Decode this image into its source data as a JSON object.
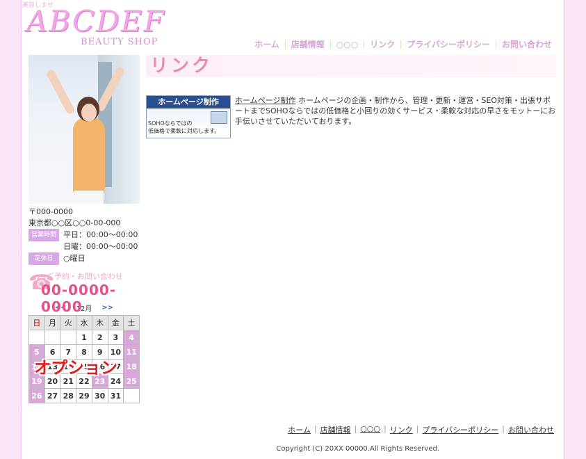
{
  "header": {
    "tagline": "美容しませ",
    "logo_main": "ABCDEF",
    "logo_sub": "BEAUTY  SHOP"
  },
  "global_nav": [
    {
      "label": "ホーム"
    },
    {
      "label": "店舗情報"
    },
    {
      "label": "○○○"
    },
    {
      "label": "リンク"
    },
    {
      "label": "プライバシーポリシー"
    },
    {
      "label": "お問い合わせ"
    }
  ],
  "sidebar": {
    "postal": "〒000-0000",
    "address": "東京都○○区○○0-00-000",
    "hours_label": "営業時間",
    "hours_weekday": "平日：00:00～00:00",
    "hours_sunday": "日曜：00:00～00:00",
    "closed_label": "定休日",
    "closed_value": "○曜日",
    "tel_caption": "ご予約・お問い合わせ",
    "tel_number": "00-0000-0000"
  },
  "calendar": {
    "prev": "<<",
    "next": ">>",
    "month": "12月",
    "weekdays": [
      "日",
      "月",
      "火",
      "水",
      "木",
      "金",
      "土"
    ],
    "weeks": [
      [
        "",
        "",
        "",
        "1",
        "2",
        "3",
        "4"
      ],
      [
        "5",
        "6",
        "7",
        "8",
        "9",
        "10",
        "11"
      ],
      [
        "12",
        "13",
        "14",
        "15",
        "16",
        "17",
        "18"
      ],
      [
        "19",
        "20",
        "21",
        "22",
        "23",
        "24",
        "25"
      ],
      [
        "26",
        "27",
        "28",
        "29",
        "30",
        "31",
        ""
      ]
    ],
    "overlay": "オプション"
  },
  "main": {
    "title": "リンク",
    "banner_title": "ホームページ制作",
    "banner_sub_1": "SOHOならではの",
    "banner_sub_2": "低価格で柔軟に対応します。",
    "link_label": "ホームページ制作",
    "link_desc": "ホームページの企画・制作から、管理・更新・運営・SEO対策・出張サポートまでSOHOならではの低価格と小回りの効くサービス・柔軟な対応の早さをモットーにお手伝いさせていただいております。"
  },
  "footer": {
    "nav": [
      "ホーム",
      "店舗情報",
      "○○○",
      "リンク",
      "プライバシーポリシー",
      "お問い合わせ"
    ],
    "copyright": "Copyright (C) 20XX 00000.All Rights Reserved."
  }
}
